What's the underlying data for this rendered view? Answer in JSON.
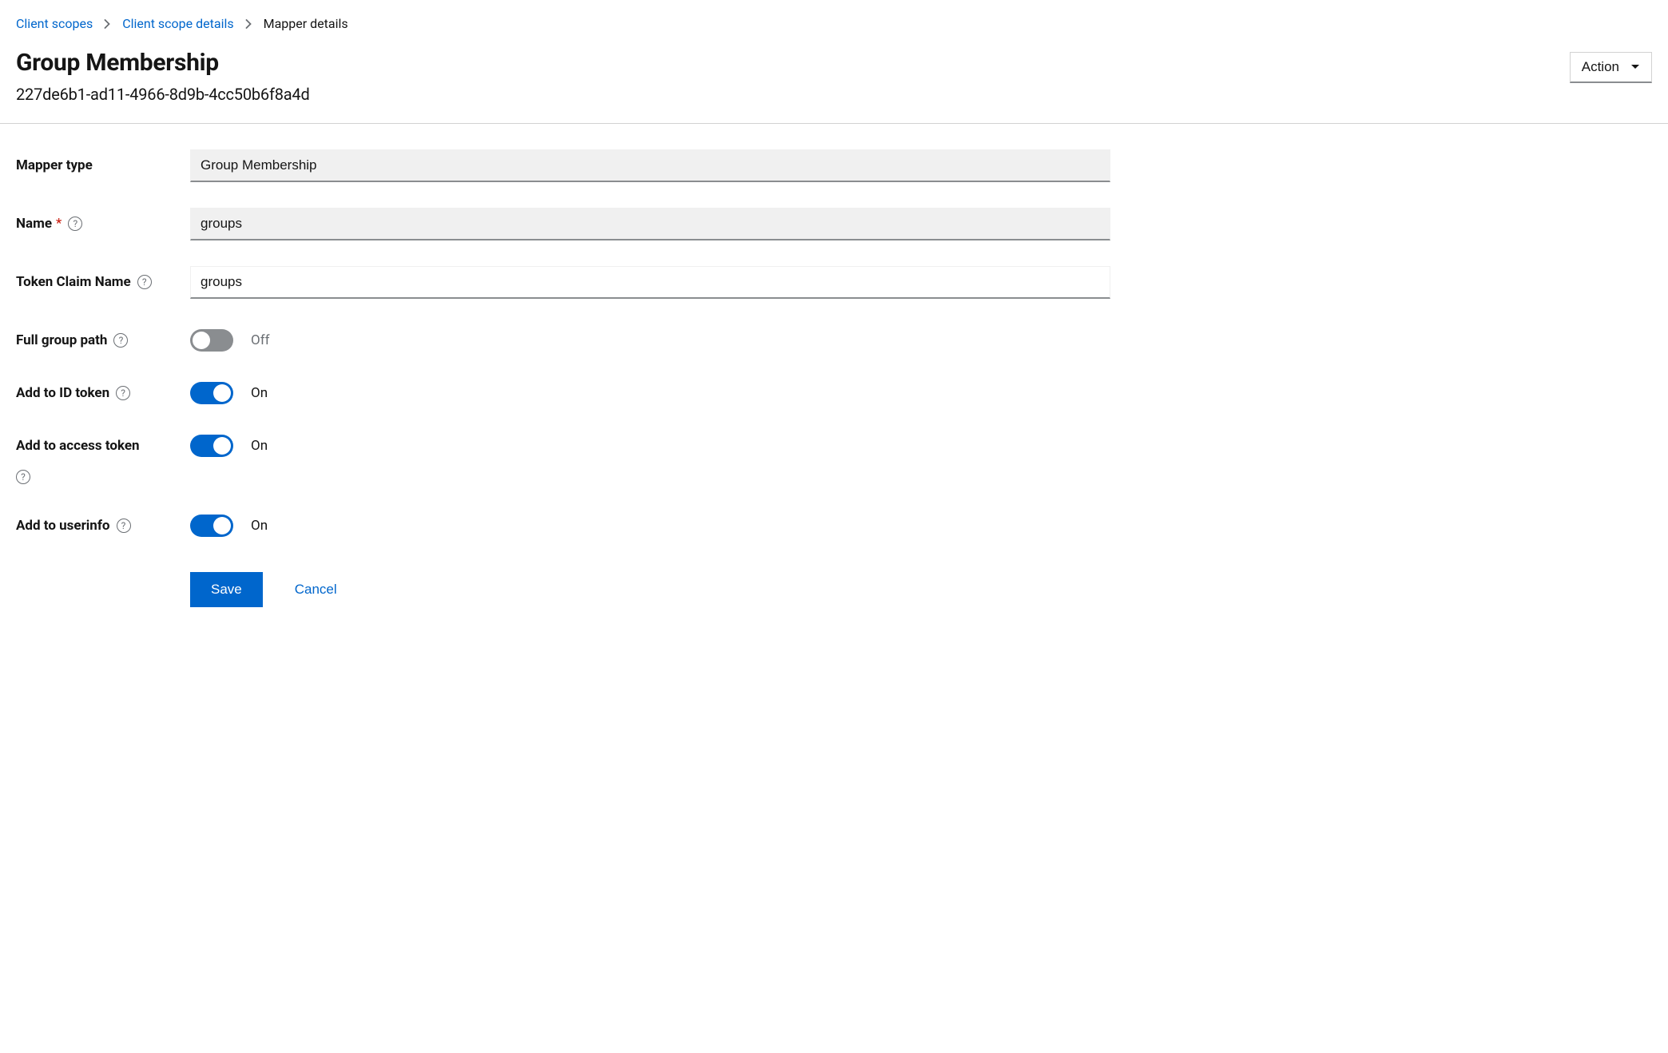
{
  "breadcrumb": {
    "client_scopes": "Client scopes",
    "client_scope_details": "Client scope details",
    "mapper_details": "Mapper details"
  },
  "header": {
    "title": "Group Membership",
    "uuid": "227de6b1-ad11-4966-8d9b-4cc50b6f8a4d",
    "action_label": "Action"
  },
  "form": {
    "mapper_type": {
      "label": "Mapper type",
      "value": "Group Membership"
    },
    "name": {
      "label": "Name",
      "value": "groups"
    },
    "token_claim_name": {
      "label": "Token Claim Name",
      "value": "groups"
    },
    "full_group_path": {
      "label": "Full group path",
      "value": false,
      "text": "Off"
    },
    "add_to_id_token": {
      "label": "Add to ID token",
      "value": true,
      "text": "On"
    },
    "add_to_access_token": {
      "label": "Add to access token",
      "value": true,
      "text": "On"
    },
    "add_to_userinfo": {
      "label": "Add to userinfo",
      "value": true,
      "text": "On"
    }
  },
  "buttons": {
    "save": "Save",
    "cancel": "Cancel"
  }
}
